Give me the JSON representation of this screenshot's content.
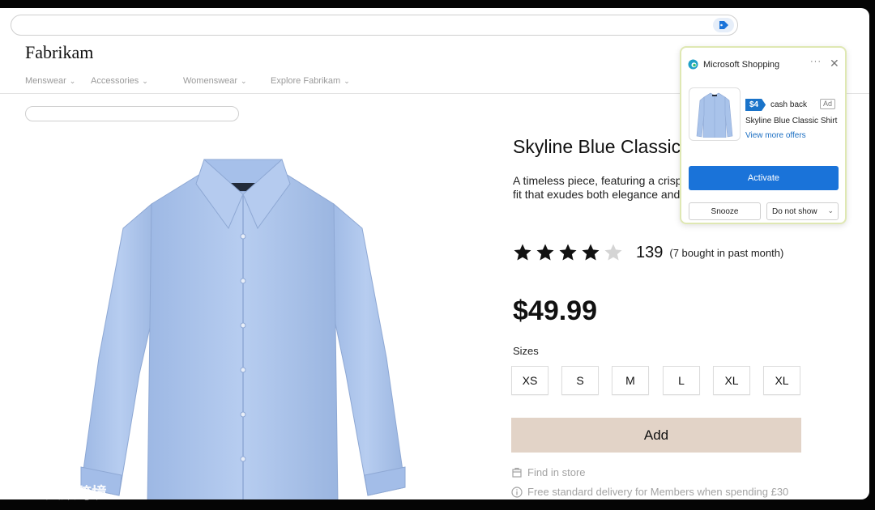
{
  "site": {
    "brand": "Fabrikam",
    "nav": [
      {
        "label": "Menswear"
      },
      {
        "label": "Accessories"
      },
      {
        "label": "Womenswear"
      },
      {
        "label": "Explore Fabrikam"
      }
    ]
  },
  "product": {
    "title": "Skyline Blue Classic",
    "description_line1": "A timeless piece, featuring a crisp",
    "description_line2": "fit that exudes both elegance and",
    "rating_stars": 4,
    "rating_max": 5,
    "rating_count": "139",
    "rating_note": "(7 bought in past month)",
    "price": "$49.99",
    "sizes_label": "Sizes",
    "sizes": [
      "XS",
      "S",
      "M",
      "L",
      "XL",
      "XL"
    ],
    "add_label": "Add",
    "find_in_store": "Find in store",
    "delivery_note": "Free standard delivery for Members when spending £30"
  },
  "shopping_flyout": {
    "title": "Microsoft Shopping",
    "more_label": "···",
    "close_label": "✕",
    "cashback_amount": "$4",
    "cashback_text": "cash back",
    "ad_label": "Ad",
    "product_name": "Skyline Blue Classic Shirt",
    "view_more": "View more offers",
    "activate_label": "Activate",
    "snooze_label": "Snooze",
    "do_not_show_label": "Do not show"
  },
  "watermark": {
    "text": "大数跨境"
  },
  "colors": {
    "accent": "#1a73d9",
    "add_button": "#e2d3c7",
    "shirt": "#a9c3ea",
    "flyout_border": "#dfe8b3"
  }
}
